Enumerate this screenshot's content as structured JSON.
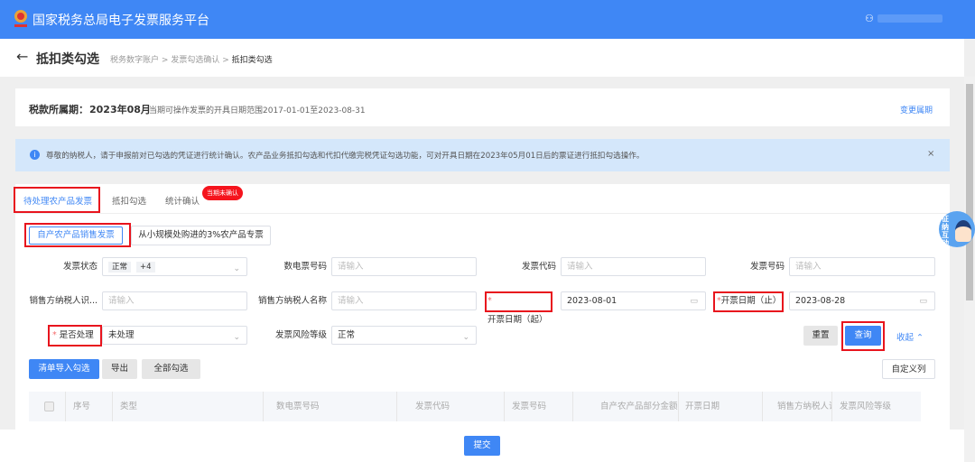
{
  "header": {
    "title": "国家税务总局电子发票服务平台"
  },
  "page": {
    "title": "抵扣类勾选",
    "breadcrumb": [
      "税务数字账户",
      "发票勾选确认",
      "抵扣类勾选"
    ],
    "sep": ">"
  },
  "period": {
    "label": "税款所属期：",
    "value": "2023年08月",
    "range": "当期可操作发票的开具日期范围2017-01-01至2023-08-31",
    "change": "变更属期"
  },
  "notice": {
    "text": "尊敬的纳税人，请于申报前对已勾选的凭证进行统计确认。农产品业务抵扣勾选和代扣代缴完税凭证勾选功能，可对开具日期在2023年05月01日后的票证进行抵扣勾选操作。",
    "close": "×"
  },
  "tabs": [
    {
      "label": "待处理农产品发票"
    },
    {
      "label": "抵扣勾选"
    },
    {
      "label": "统计确认"
    }
  ],
  "badge": "当期未确认",
  "subtabs": [
    "自产农产品销售发票",
    "从小规模处购进的3%农产品专票"
  ],
  "form": {
    "status_label": "发票状态",
    "status_tag": "正常",
    "status_more": "+4",
    "digital_label": "数电票号码",
    "code_label": "发票代码",
    "number_label": "发票号码",
    "seller_id_label": "销售方纳税人识...",
    "seller_name_label": "销售方纳税人名称",
    "start_label": "开票日期（起）",
    "start_value": "2023-08-01",
    "end_label": "开票日期（止）",
    "end_value": "2023-08-28",
    "processed_label": "是否处理",
    "processed_value": "未处理",
    "risk_label": "发票风险等级",
    "risk_value": "正常",
    "placeholder": "请输入",
    "required": "*"
  },
  "actions": {
    "reset": "重置",
    "query": "查询",
    "collapse": "收起",
    "import": "清单导入勾选",
    "export": "导出",
    "select_all": "全部勾选",
    "custom_cols": "自定义列",
    "submit": "提交"
  },
  "table": {
    "columns": [
      "序号",
      "类型",
      "数电票号码",
      "发票代码",
      "发票号码",
      "自产农产品部分金额",
      "开票日期",
      "销售方纳税人识别",
      "发票风险等级"
    ]
  },
  "float": {
    "label": "征纳互动"
  }
}
